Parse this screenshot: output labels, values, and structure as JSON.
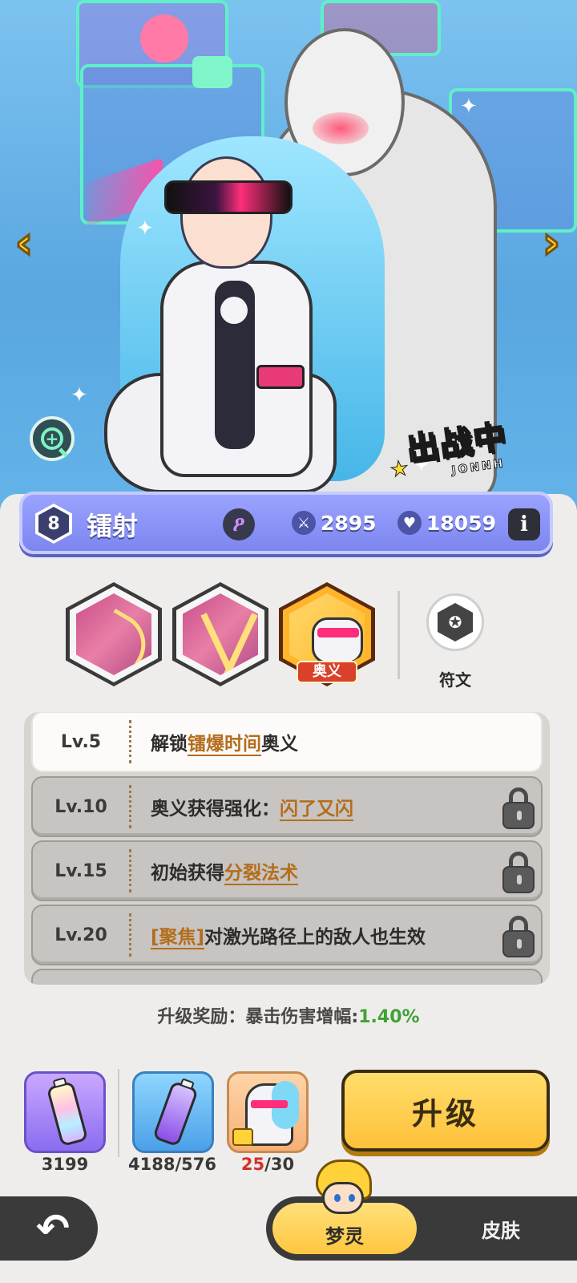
{
  "hero": {
    "name": "镭射",
    "level": "8",
    "attack": "2895",
    "hp": "18059",
    "deploy_badge": "出战中",
    "deploy_badge_sub": "JONNH"
  },
  "icons": {
    "nav_left": "chevron-left-icon",
    "nav_right": "chevron-right-icon",
    "zoom": "zoom-in-icon",
    "class": "mage-class-icon",
    "attack": "sword-icon",
    "hp": "heart-icon",
    "info": "info-icon",
    "rune": "rune-icon",
    "lock": "lock-icon",
    "back": "back-arrow-icon"
  },
  "skills": {
    "ultimate_tag": "奥义",
    "rune_label": "符文"
  },
  "levels": [
    {
      "lv": "Lv.5",
      "pre": "解锁",
      "hl": "镭爆时间",
      "post": "奥义",
      "locked": false
    },
    {
      "lv": "Lv.10",
      "pre": "奥义获得强化：",
      "hl": "闪了又闪",
      "post": "",
      "locked": true
    },
    {
      "lv": "Lv.15",
      "pre": "初始获得",
      "hl": "分裂法术",
      "post": "",
      "locked": true
    },
    {
      "lv": "Lv.20",
      "pre": "",
      "hl": "[聚焦]",
      "post": "对激光路径上的敌人也生效",
      "locked": true
    }
  ],
  "reward": {
    "label": "升级奖励：暴击伤害增幅:",
    "value": "1.40%"
  },
  "materials": {
    "m1_count": "3199",
    "m2_count": "4188/576",
    "m3_have": "25",
    "m3_need": "/30"
  },
  "upgrade_label": "升级",
  "tabs": {
    "active": "梦灵",
    "inactive": "皮肤"
  },
  "colors": {
    "accent_yellow": "#ffc640",
    "name_bar": "#8f97fb",
    "highlight_text": "#b46d1c",
    "reward_value": "#3fa236",
    "shard_count_red": "#d3302a"
  }
}
